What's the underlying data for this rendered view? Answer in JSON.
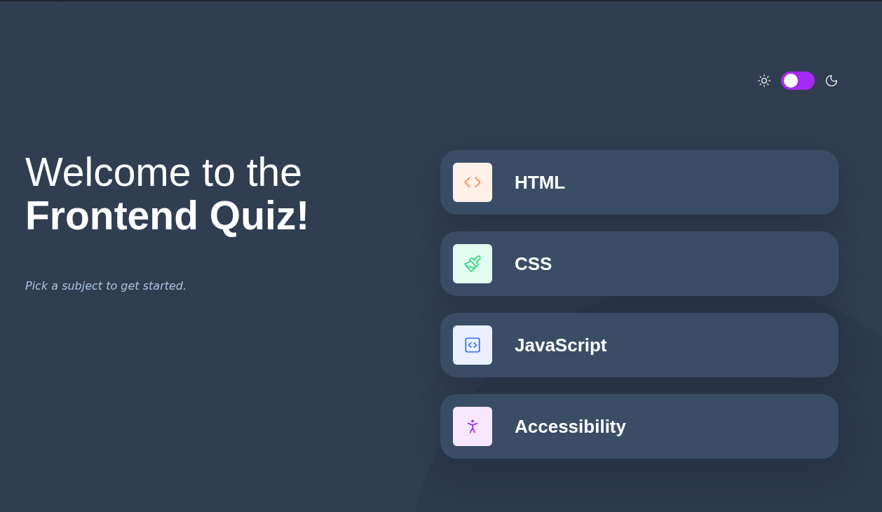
{
  "theme_toggle": {
    "on": false
  },
  "heading": {
    "light_line": "Welcome to the",
    "bold_line": "Frontend Quiz!"
  },
  "subtitle": "Pick a subject to get started.",
  "subjects": [
    {
      "kind": "html",
      "label": "HTML",
      "color": "#fff1e9"
    },
    {
      "kind": "css",
      "label": "CSS",
      "color": "#e0fdef"
    },
    {
      "kind": "javascript",
      "label": "JavaScript",
      "color": "#ebf0ff"
    },
    {
      "kind": "accessibility",
      "label": "Accessibility",
      "color": "#f6e7ff"
    }
  ]
}
